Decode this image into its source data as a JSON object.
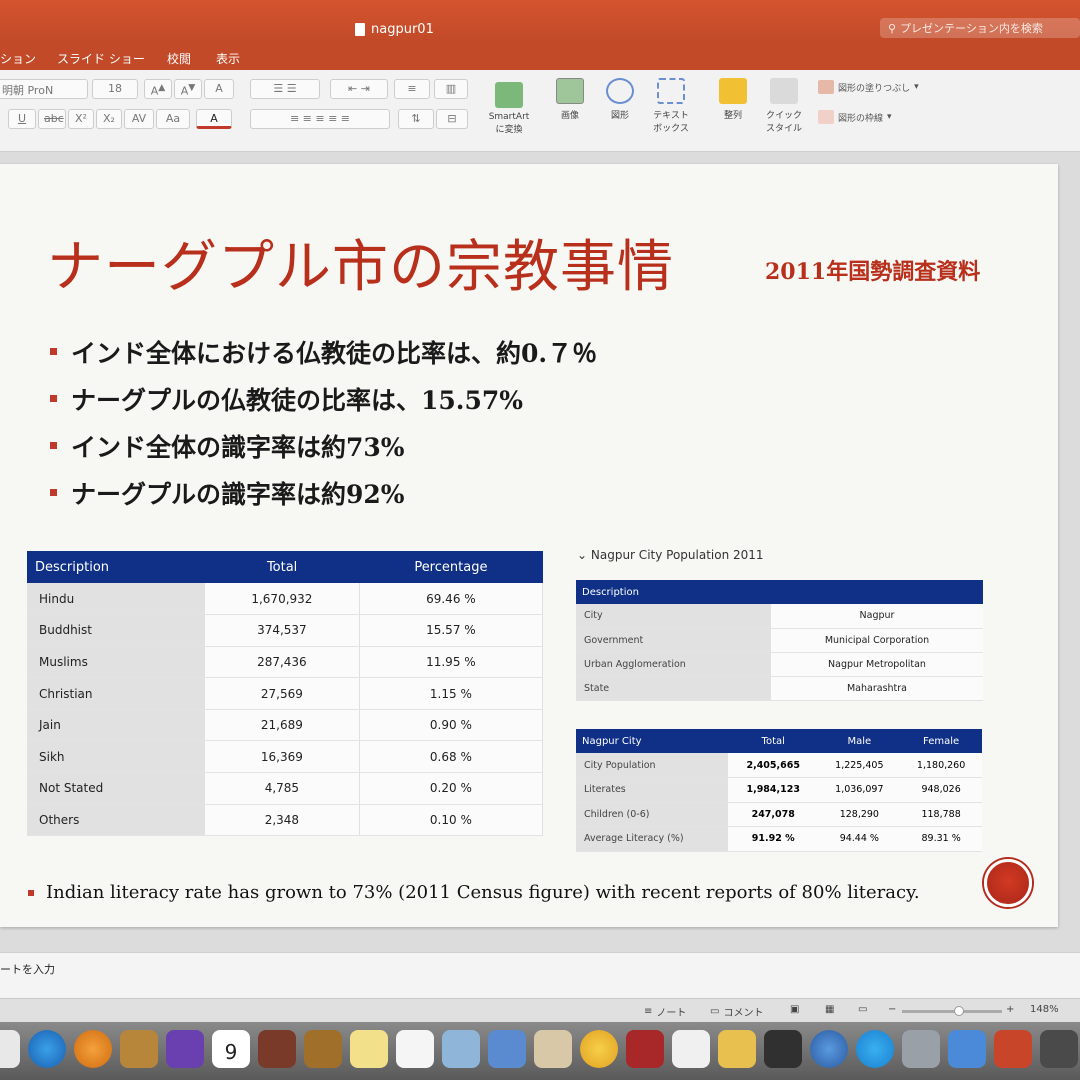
{
  "window": {
    "doc_title": "nagpur01",
    "search_placeholder": "プレゼンテーション内を検索"
  },
  "menu": [
    "ション",
    "スライド ショー",
    "校閲",
    "表示"
  ],
  "ribbon": {
    "font_name": "明朝 ProN",
    "font_size": "18",
    "smartart": "SmartArt\nに変換",
    "picture": "画像",
    "shape": "図形",
    "textbox": "テキスト\nボックス",
    "arrange": "整列",
    "quick_style": "クイック\nスタイル",
    "shape_fill": "図形の塗りつぶし",
    "shape_outline": "図形の枠線"
  },
  "slide": {
    "title": "ナーグプル市の宗教事情",
    "subtitle": "2011年国勢調査資料",
    "bullets": [
      "インド全体における仏教徒の比率は、約0.７％",
      "ナーグプルの仏教徒の比率は、15.57%",
      "インド全体の識字率は約73%",
      "ナーグプルの識字率は約92%"
    ],
    "religion_table": {
      "headers": [
        "Description",
        "Total",
        "Percentage"
      ],
      "rows": [
        [
          "Hindu",
          "1,670,932",
          "69.46 %"
        ],
        [
          "Buddhist",
          "374,537",
          "15.57 %"
        ],
        [
          "Muslims",
          "287,436",
          "11.95 %"
        ],
        [
          "Christian",
          "27,569",
          "1.15 %"
        ],
        [
          "Jain",
          "21,689",
          "0.90 %"
        ],
        [
          "Sikh",
          "16,369",
          "0.68 %"
        ],
        [
          "Not Stated",
          "4,785",
          "0.20 %"
        ],
        [
          "Others",
          "2,348",
          "0.10 %"
        ]
      ]
    },
    "right_caption": "Nagpur City Population 2011",
    "info_table": {
      "header": "Description",
      "rows": [
        [
          "City",
          "Nagpur"
        ],
        [
          "Government",
          "Municipal Corporation"
        ],
        [
          "Urban Agglomeration",
          "Nagpur Metropolitan"
        ],
        [
          "State",
          "Maharashtra"
        ]
      ]
    },
    "city_table": {
      "headers": [
        "Nagpur City",
        "Total",
        "Male",
        "Female"
      ],
      "rows": [
        [
          "City Population",
          "2,405,665",
          "1,225,405",
          "1,180,260"
        ],
        [
          "Literates",
          "1,984,123",
          "1,036,097",
          "948,026"
        ],
        [
          "Children (0-6)",
          "247,078",
          "128,290",
          "118,788"
        ],
        [
          "Average Literacy (%)",
          "91.92 %",
          "94.44 %",
          "89.31 %"
        ]
      ]
    },
    "footnote": "Indian literacy rate has grown to 73% (2011 Census figure) with recent reports of 80% literacy."
  },
  "notes_placeholder": "ートを入力",
  "status": {
    "notes": "ノート",
    "comments": "コメント",
    "zoom": "148%"
  },
  "dock": {
    "calendar_day": "9"
  }
}
